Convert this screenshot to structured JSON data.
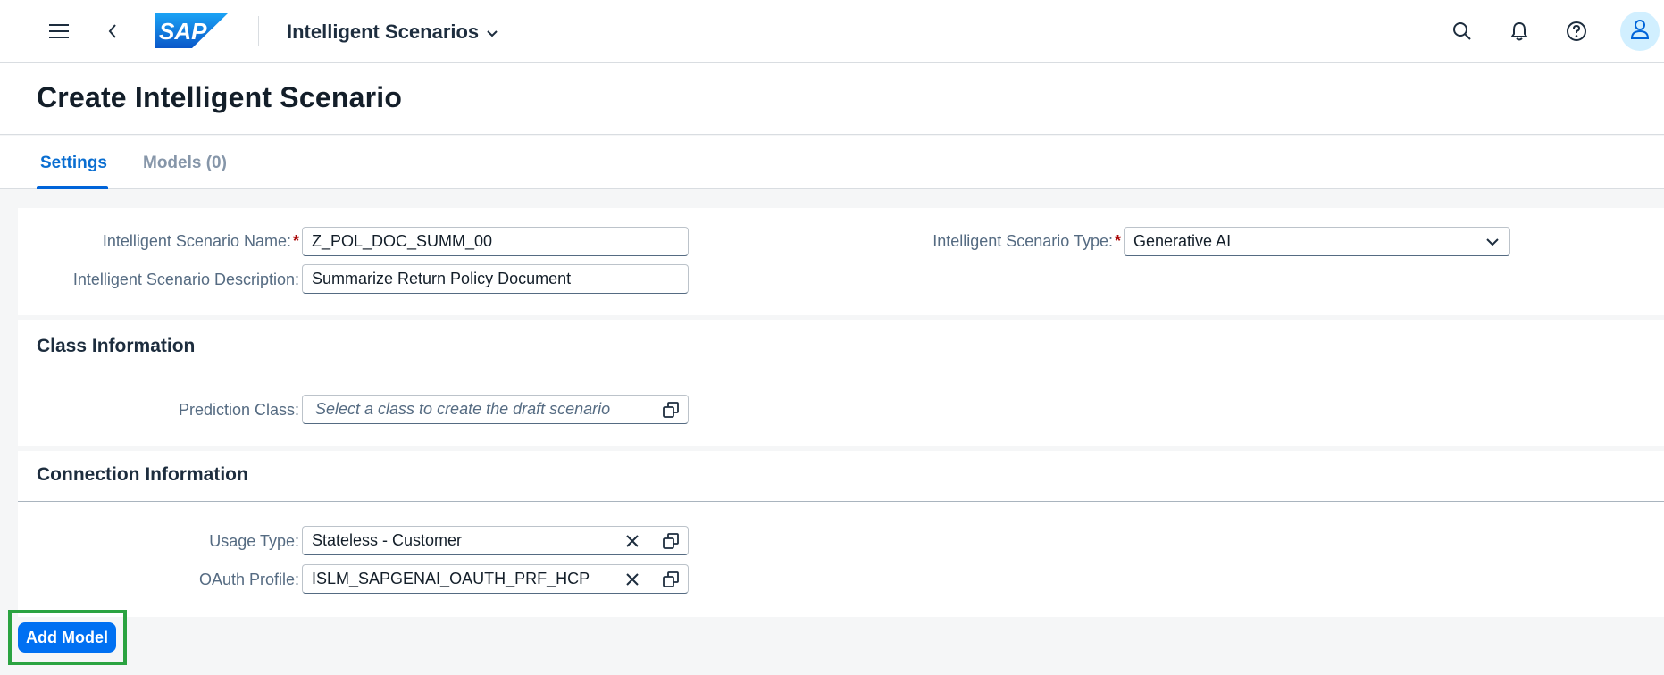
{
  "shell": {
    "logo_text": "SAP",
    "app_title": "Intelligent Scenarios",
    "icons": [
      "menu-icon",
      "back-icon",
      "search-icon",
      "bell-icon",
      "help-icon",
      "user-icon"
    ]
  },
  "page": {
    "title": "Create Intelligent Scenario"
  },
  "tabs": [
    {
      "label": "Settings",
      "active": true
    },
    {
      "label": "Models (0)",
      "active": false
    }
  ],
  "general": {
    "name_label": "Intelligent Scenario Name:",
    "name_value": "Z_POL_DOC_SUMM_00",
    "description_label": "Intelligent Scenario Description:",
    "description_value": "Summarize Return Policy Document",
    "type_label": "Intelligent Scenario Type:",
    "type_value": "Generative AI",
    "required_marker": "*"
  },
  "class_info": {
    "title": "Class Information",
    "prediction_label": "Prediction Class:",
    "prediction_placeholder": "Select a class to create the draft scenario"
  },
  "connection_info": {
    "title": "Connection Information",
    "usage_label": "Usage Type:",
    "usage_value": "Stateless - Customer",
    "oauth_label": "OAuth Profile:",
    "oauth_value": "ISLM_SAPGENAI_OAUTH_PRF_HCP"
  },
  "footer": {
    "add_model_label": "Add Model"
  },
  "colors": {
    "accent": "#0070f2",
    "tab_active": "#0a6ed1",
    "highlight_border": "#2ba341",
    "required": "#aa0808"
  }
}
